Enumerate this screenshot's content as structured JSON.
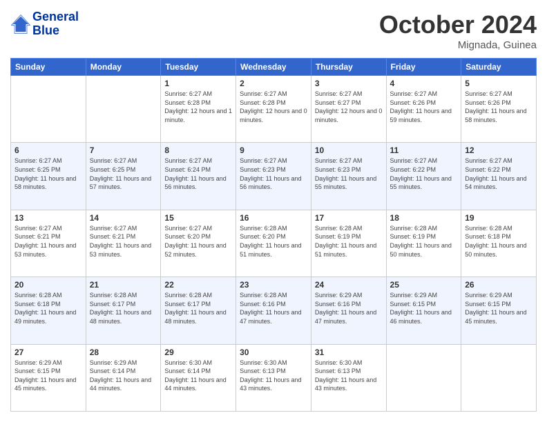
{
  "header": {
    "logo_line1": "General",
    "logo_line2": "Blue",
    "month": "October 2024",
    "location": "Mignada, Guinea"
  },
  "weekdays": [
    "Sunday",
    "Monday",
    "Tuesday",
    "Wednesday",
    "Thursday",
    "Friday",
    "Saturday"
  ],
  "weeks": [
    [
      {
        "day": "",
        "sunrise": "",
        "sunset": "",
        "daylight": ""
      },
      {
        "day": "",
        "sunrise": "",
        "sunset": "",
        "daylight": ""
      },
      {
        "day": "1",
        "sunrise": "Sunrise: 6:27 AM",
        "sunset": "Sunset: 6:28 PM",
        "daylight": "Daylight: 12 hours and 1 minute."
      },
      {
        "day": "2",
        "sunrise": "Sunrise: 6:27 AM",
        "sunset": "Sunset: 6:28 PM",
        "daylight": "Daylight: 12 hours and 0 minutes."
      },
      {
        "day": "3",
        "sunrise": "Sunrise: 6:27 AM",
        "sunset": "Sunset: 6:27 PM",
        "daylight": "Daylight: 12 hours and 0 minutes."
      },
      {
        "day": "4",
        "sunrise": "Sunrise: 6:27 AM",
        "sunset": "Sunset: 6:26 PM",
        "daylight": "Daylight: 11 hours and 59 minutes."
      },
      {
        "day": "5",
        "sunrise": "Sunrise: 6:27 AM",
        "sunset": "Sunset: 6:26 PM",
        "daylight": "Daylight: 11 hours and 58 minutes."
      }
    ],
    [
      {
        "day": "6",
        "sunrise": "Sunrise: 6:27 AM",
        "sunset": "Sunset: 6:25 PM",
        "daylight": "Daylight: 11 hours and 58 minutes."
      },
      {
        "day": "7",
        "sunrise": "Sunrise: 6:27 AM",
        "sunset": "Sunset: 6:25 PM",
        "daylight": "Daylight: 11 hours and 57 minutes."
      },
      {
        "day": "8",
        "sunrise": "Sunrise: 6:27 AM",
        "sunset": "Sunset: 6:24 PM",
        "daylight": "Daylight: 11 hours and 56 minutes."
      },
      {
        "day": "9",
        "sunrise": "Sunrise: 6:27 AM",
        "sunset": "Sunset: 6:23 PM",
        "daylight": "Daylight: 11 hours and 56 minutes."
      },
      {
        "day": "10",
        "sunrise": "Sunrise: 6:27 AM",
        "sunset": "Sunset: 6:23 PM",
        "daylight": "Daylight: 11 hours and 55 minutes."
      },
      {
        "day": "11",
        "sunrise": "Sunrise: 6:27 AM",
        "sunset": "Sunset: 6:22 PM",
        "daylight": "Daylight: 11 hours and 55 minutes."
      },
      {
        "day": "12",
        "sunrise": "Sunrise: 6:27 AM",
        "sunset": "Sunset: 6:22 PM",
        "daylight": "Daylight: 11 hours and 54 minutes."
      }
    ],
    [
      {
        "day": "13",
        "sunrise": "Sunrise: 6:27 AM",
        "sunset": "Sunset: 6:21 PM",
        "daylight": "Daylight: 11 hours and 53 minutes."
      },
      {
        "day": "14",
        "sunrise": "Sunrise: 6:27 AM",
        "sunset": "Sunset: 6:21 PM",
        "daylight": "Daylight: 11 hours and 53 minutes."
      },
      {
        "day": "15",
        "sunrise": "Sunrise: 6:27 AM",
        "sunset": "Sunset: 6:20 PM",
        "daylight": "Daylight: 11 hours and 52 minutes."
      },
      {
        "day": "16",
        "sunrise": "Sunrise: 6:28 AM",
        "sunset": "Sunset: 6:20 PM",
        "daylight": "Daylight: 11 hours and 51 minutes."
      },
      {
        "day": "17",
        "sunrise": "Sunrise: 6:28 AM",
        "sunset": "Sunset: 6:19 PM",
        "daylight": "Daylight: 11 hours and 51 minutes."
      },
      {
        "day": "18",
        "sunrise": "Sunrise: 6:28 AM",
        "sunset": "Sunset: 6:19 PM",
        "daylight": "Daylight: 11 hours and 50 minutes."
      },
      {
        "day": "19",
        "sunrise": "Sunrise: 6:28 AM",
        "sunset": "Sunset: 6:18 PM",
        "daylight": "Daylight: 11 hours and 50 minutes."
      }
    ],
    [
      {
        "day": "20",
        "sunrise": "Sunrise: 6:28 AM",
        "sunset": "Sunset: 6:18 PM",
        "daylight": "Daylight: 11 hours and 49 minutes."
      },
      {
        "day": "21",
        "sunrise": "Sunrise: 6:28 AM",
        "sunset": "Sunset: 6:17 PM",
        "daylight": "Daylight: 11 hours and 48 minutes."
      },
      {
        "day": "22",
        "sunrise": "Sunrise: 6:28 AM",
        "sunset": "Sunset: 6:17 PM",
        "daylight": "Daylight: 11 hours and 48 minutes."
      },
      {
        "day": "23",
        "sunrise": "Sunrise: 6:28 AM",
        "sunset": "Sunset: 6:16 PM",
        "daylight": "Daylight: 11 hours and 47 minutes."
      },
      {
        "day": "24",
        "sunrise": "Sunrise: 6:29 AM",
        "sunset": "Sunset: 6:16 PM",
        "daylight": "Daylight: 11 hours and 47 minutes."
      },
      {
        "day": "25",
        "sunrise": "Sunrise: 6:29 AM",
        "sunset": "Sunset: 6:15 PM",
        "daylight": "Daylight: 11 hours and 46 minutes."
      },
      {
        "day": "26",
        "sunrise": "Sunrise: 6:29 AM",
        "sunset": "Sunset: 6:15 PM",
        "daylight": "Daylight: 11 hours and 45 minutes."
      }
    ],
    [
      {
        "day": "27",
        "sunrise": "Sunrise: 6:29 AM",
        "sunset": "Sunset: 6:15 PM",
        "daylight": "Daylight: 11 hours and 45 minutes."
      },
      {
        "day": "28",
        "sunrise": "Sunrise: 6:29 AM",
        "sunset": "Sunset: 6:14 PM",
        "daylight": "Daylight: 11 hours and 44 minutes."
      },
      {
        "day": "29",
        "sunrise": "Sunrise: 6:30 AM",
        "sunset": "Sunset: 6:14 PM",
        "daylight": "Daylight: 11 hours and 44 minutes."
      },
      {
        "day": "30",
        "sunrise": "Sunrise: 6:30 AM",
        "sunset": "Sunset: 6:13 PM",
        "daylight": "Daylight: 11 hours and 43 minutes."
      },
      {
        "day": "31",
        "sunrise": "Sunrise: 6:30 AM",
        "sunset": "Sunset: 6:13 PM",
        "daylight": "Daylight: 11 hours and 43 minutes."
      },
      {
        "day": "",
        "sunrise": "",
        "sunset": "",
        "daylight": ""
      },
      {
        "day": "",
        "sunrise": "",
        "sunset": "",
        "daylight": ""
      }
    ]
  ]
}
